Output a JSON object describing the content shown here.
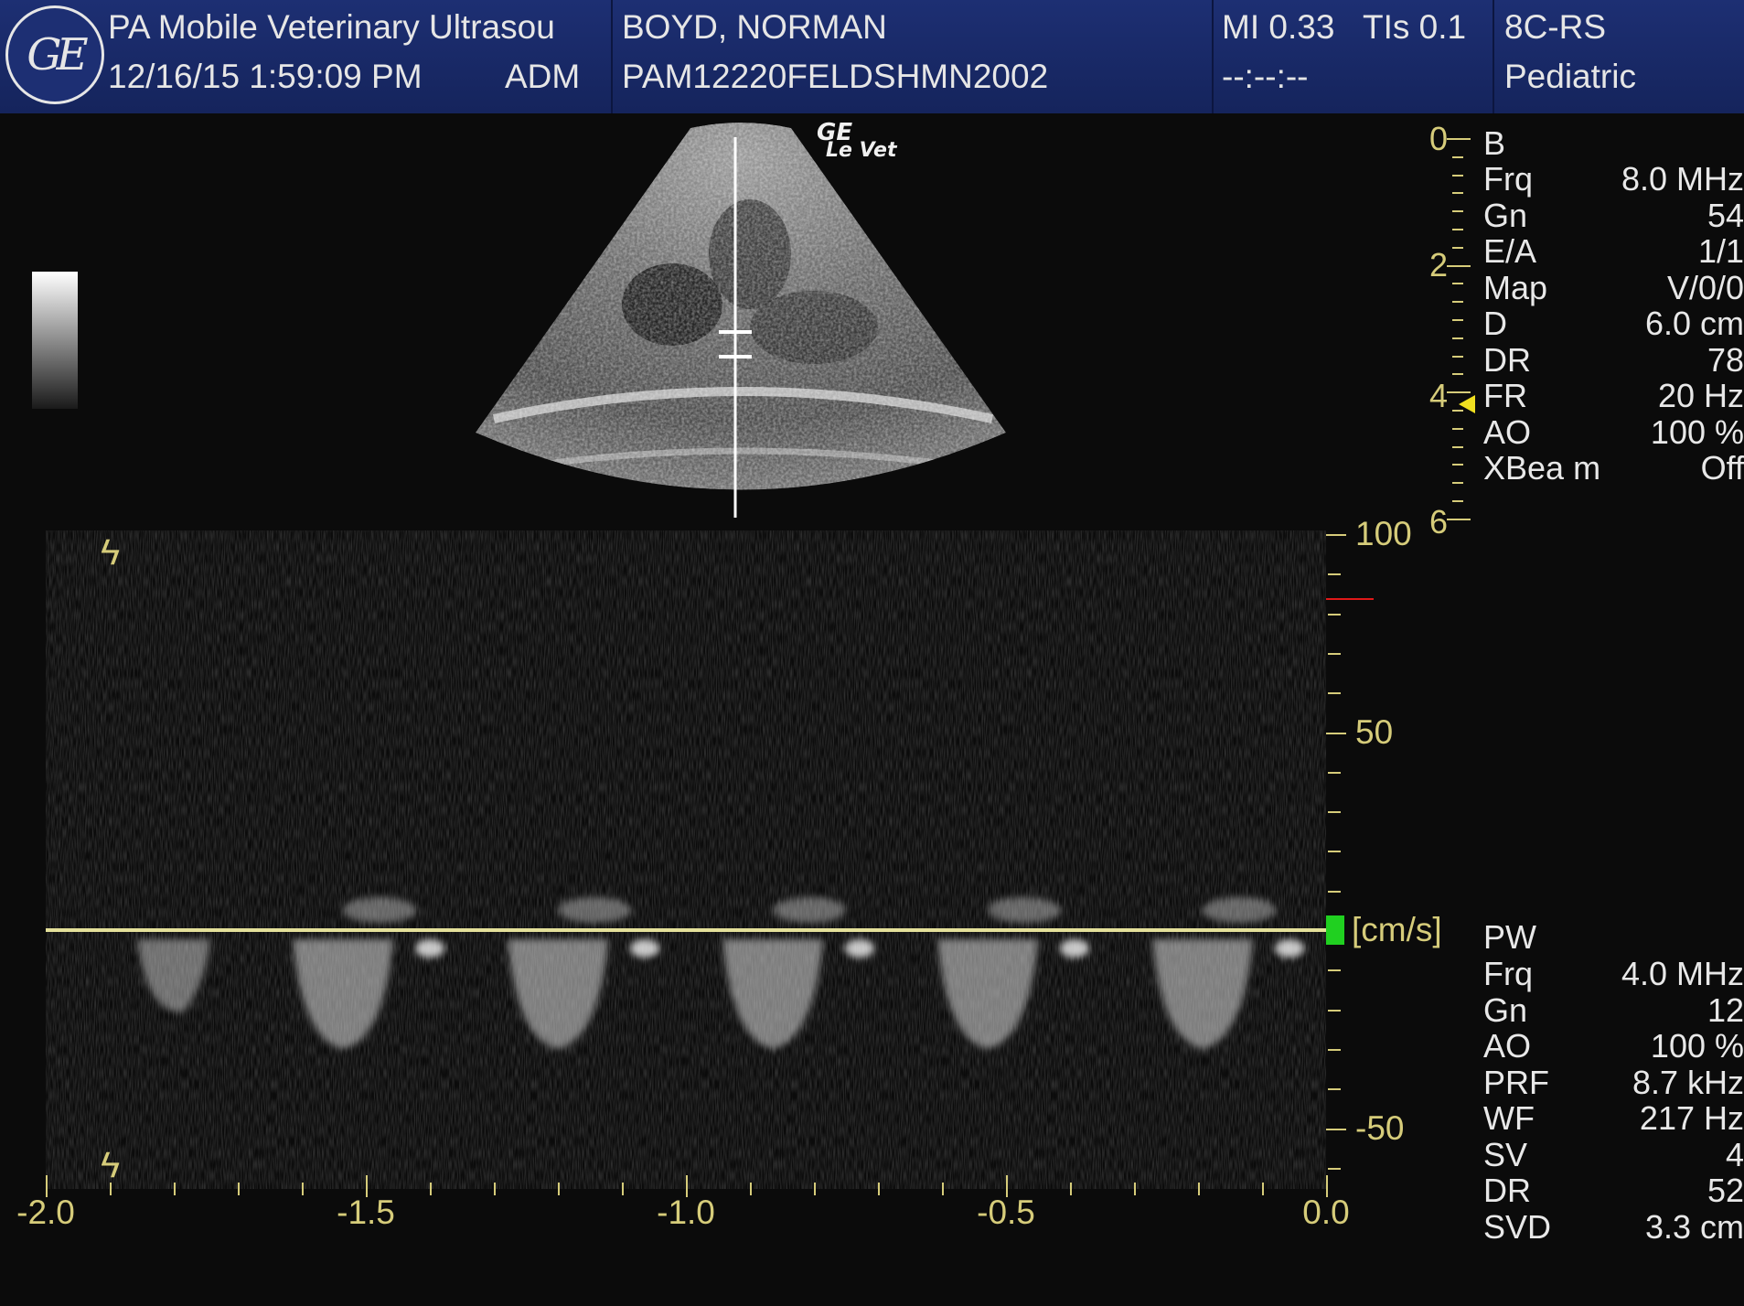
{
  "header": {
    "logo": "GE",
    "institution": "PA Mobile Veterinary Ultrasou",
    "datetime": "12/16/15 1:59:09 PM",
    "operator": "ADM",
    "patient_name": "BOYD, NORMAN",
    "patient_id": "PAM12220FELDSHMN2002",
    "mi": "MI 0.33",
    "tis": "TIs 0.1",
    "clock": "--:--:--",
    "probe": "8C-RS",
    "preset": "Pediatric"
  },
  "image_logo": {
    "brand": "GE",
    "model": "Le Vet"
  },
  "depth_scale": {
    "labels": [
      "0",
      "2",
      "4",
      "6"
    ],
    "unit_note": "cm"
  },
  "b_mode": {
    "title": "B",
    "rows": [
      {
        "label": "Frq",
        "value": "8.0 MHz"
      },
      {
        "label": "Gn",
        "value": "54"
      },
      {
        "label": "E/A",
        "value": "1/1"
      },
      {
        "label": "Map",
        "value": "V/0/0"
      },
      {
        "label": "D",
        "value": "6.0 cm"
      },
      {
        "label": "DR",
        "value": "78"
      },
      {
        "label": "FR",
        "value": "20 Hz"
      },
      {
        "label": "AO",
        "value": "100 %"
      },
      {
        "label": "XBea m",
        "value": "Off"
      }
    ]
  },
  "pw_mode": {
    "title": "PW",
    "rows": [
      {
        "label": "Frq",
        "value": "4.0 MHz"
      },
      {
        "label": "Gn",
        "value": "12"
      },
      {
        "label": "AO",
        "value": "100 %"
      },
      {
        "label": "PRF",
        "value": "8.7 kHz"
      },
      {
        "label": "WF",
        "value": "217 Hz"
      },
      {
        "label": "SV",
        "value": "4"
      },
      {
        "label": "DR",
        "value": "52"
      },
      {
        "label": "SVD",
        "value": "3.3 cm"
      }
    ]
  },
  "spectral": {
    "velocity_labels": [
      "100",
      "50",
      "-50"
    ],
    "unit": "[cm/s]",
    "time_labels": [
      "-2.0",
      "-1.5",
      "-1.0",
      "-0.5",
      "0.0"
    ],
    "colors": {
      "scale": "#d6cc7a",
      "baseline": "#e4e09a",
      "marker": "#20d020",
      "red_mark": "#e01818"
    }
  }
}
